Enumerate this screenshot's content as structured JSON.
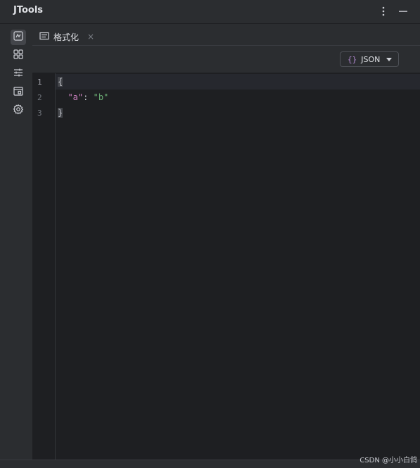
{
  "app": {
    "title": "JTools"
  },
  "title_actions": [
    {
      "icon": "more-vertical-icon"
    },
    {
      "icon": "minimize-icon"
    }
  ],
  "sidebar": {
    "items": [
      {
        "icon": "formatter-icon",
        "active": true
      },
      {
        "icon": "grid-icon",
        "active": false
      },
      {
        "icon": "sliders-icon",
        "active": false
      },
      {
        "icon": "calendar-icon",
        "active": false
      },
      {
        "icon": "gear-icon",
        "active": false
      }
    ]
  },
  "tab": {
    "label": "格式化",
    "close": "×",
    "icon": "format-tab-icon"
  },
  "language_select": {
    "braces": "{}",
    "value": "JSON"
  },
  "editor": {
    "line_numbers": [
      "1",
      "2",
      "3"
    ],
    "lines": [
      {
        "open_brace": "{"
      },
      {
        "indent": "  ",
        "key": "\"a\"",
        "colon": ": ",
        "value": "\"b\""
      },
      {
        "close_brace": "}"
      }
    ]
  },
  "watermark": "CSDN @小小白鸽",
  "colors": {
    "background": "#2b2d30",
    "editor_bg": "#1e1f22",
    "json_key": "#c77dbb",
    "json_string": "#6aab73",
    "braces_icon": "#b58bd5"
  }
}
